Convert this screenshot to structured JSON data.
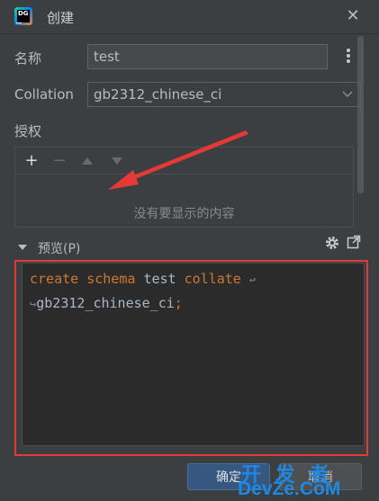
{
  "window": {
    "title": "创建"
  },
  "form": {
    "name_label": "名称",
    "name_value": "test",
    "collation_label": "Collation",
    "collation_value": "gb2312_chinese_ci",
    "auth_label": "授权"
  },
  "auth_panel": {
    "empty_text": "没有要显示的内容"
  },
  "preview": {
    "label": "预览(P)",
    "code_line1": [
      "create",
      "schema",
      "test",
      "collate"
    ],
    "code_line2": [
      "gb2312_chinese_ci",
      ";"
    ]
  },
  "buttons": {
    "ok_label": "确定",
    "cancel_label": "取消"
  },
  "watermark": {
    "top": "开 发 者",
    "bottom": "DevZe.CoM"
  },
  "colors": {
    "keyword": "#cc7832",
    "identifier": "#a9b7c6",
    "highlight": "#e53935"
  }
}
